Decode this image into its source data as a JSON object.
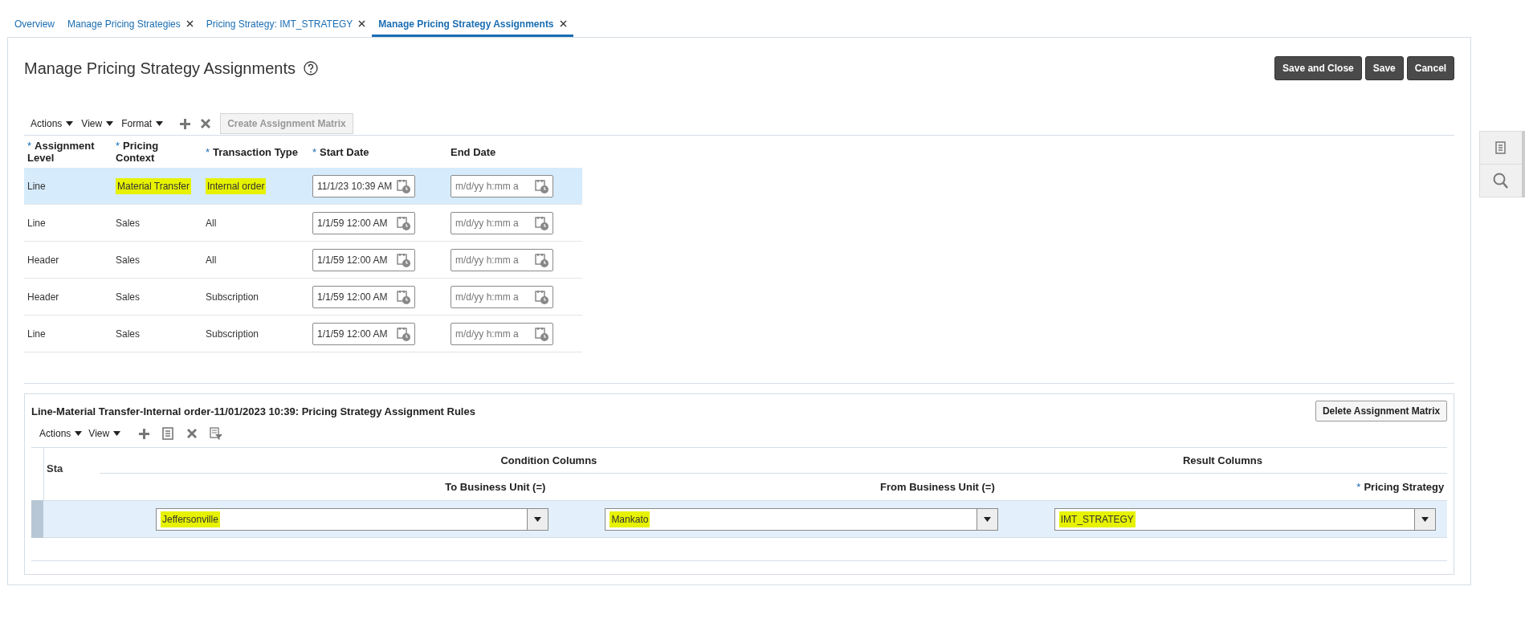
{
  "tabs": [
    {
      "label": "Overview",
      "closable": false,
      "selected": false
    },
    {
      "label": "Manage Pricing Strategies",
      "closable": true,
      "selected": false
    },
    {
      "label": "Pricing Strategy: IMT_STRATEGY",
      "closable": true,
      "selected": false
    },
    {
      "label": "Manage Pricing Strategy Assignments",
      "closable": true,
      "selected": true
    }
  ],
  "page": {
    "title": "Manage Pricing Strategy Assignments",
    "buttons": [
      "Save and Close",
      "Save",
      "Cancel"
    ]
  },
  "toolbar": {
    "menus": [
      "Actions",
      "View",
      "Format"
    ],
    "create_button": {
      "label": "Create Assignment Matrix",
      "disabled": true
    }
  },
  "table": {
    "columns": [
      {
        "label": "Assignment Level",
        "required_mark": "*"
      },
      {
        "label": "Pricing Context",
        "required_mark": "*"
      },
      {
        "label": "Transaction Type",
        "required_mark": "*"
      },
      {
        "label": "Start Date",
        "required_mark": "*"
      },
      {
        "label": "End Date"
      }
    ],
    "rows": [
      {
        "selected": true,
        "highlighted": true,
        "level": "Line",
        "context": "Material Transfer",
        "type": "Internal order",
        "start_date": "11/1/23 10:39 AM",
        "end_date_placeholder": "m/d/yy h:mm a"
      },
      {
        "selected": false,
        "highlighted": false,
        "level": "Line",
        "context": "Sales",
        "type": "All",
        "start_date": "1/1/59 12:00 AM",
        "end_date_placeholder": "m/d/yy h:mm a"
      },
      {
        "selected": false,
        "highlighted": false,
        "level": "Header",
        "context": "Sales",
        "type": "All",
        "start_date": "1/1/59 12:00 AM",
        "end_date_placeholder": "m/d/yy h:mm a"
      },
      {
        "selected": false,
        "highlighted": false,
        "level": "Header",
        "context": "Sales",
        "type": "Subscription",
        "start_date": "1/1/59 12:00 AM",
        "end_date_placeholder": "m/d/yy h:mm a"
      },
      {
        "selected": false,
        "highlighted": false,
        "level": "Line",
        "context": "Sales",
        "type": "Subscription",
        "start_date": "1/1/59 12:00 AM",
        "end_date_placeholder": "m/d/yy h:mm a"
      }
    ]
  },
  "rules": {
    "title": "Line-Material Transfer-Internal order-11/01/2023 10:39: Pricing Strategy Assignment Rules",
    "delete_button": "Delete Assignment Matrix",
    "menus": [
      "Actions",
      "View"
    ],
    "status_column": "Sta",
    "groups": [
      {
        "label": "Condition Columns"
      },
      {
        "label": "Result Columns"
      }
    ],
    "columns": [
      {
        "label": "To Business Unit (=)"
      },
      {
        "label": "From Business Unit (=)"
      },
      {
        "label": "Pricing Strategy",
        "required_mark": "*"
      }
    ],
    "rows": [
      {
        "selected": true,
        "values": [
          {
            "text": "Jeffersonville",
            "highlighted": true
          },
          {
            "text": "Mankato",
            "highlighted": true
          },
          {
            "text": "IMT_STRATEGY",
            "highlighted": true
          }
        ]
      }
    ]
  }
}
